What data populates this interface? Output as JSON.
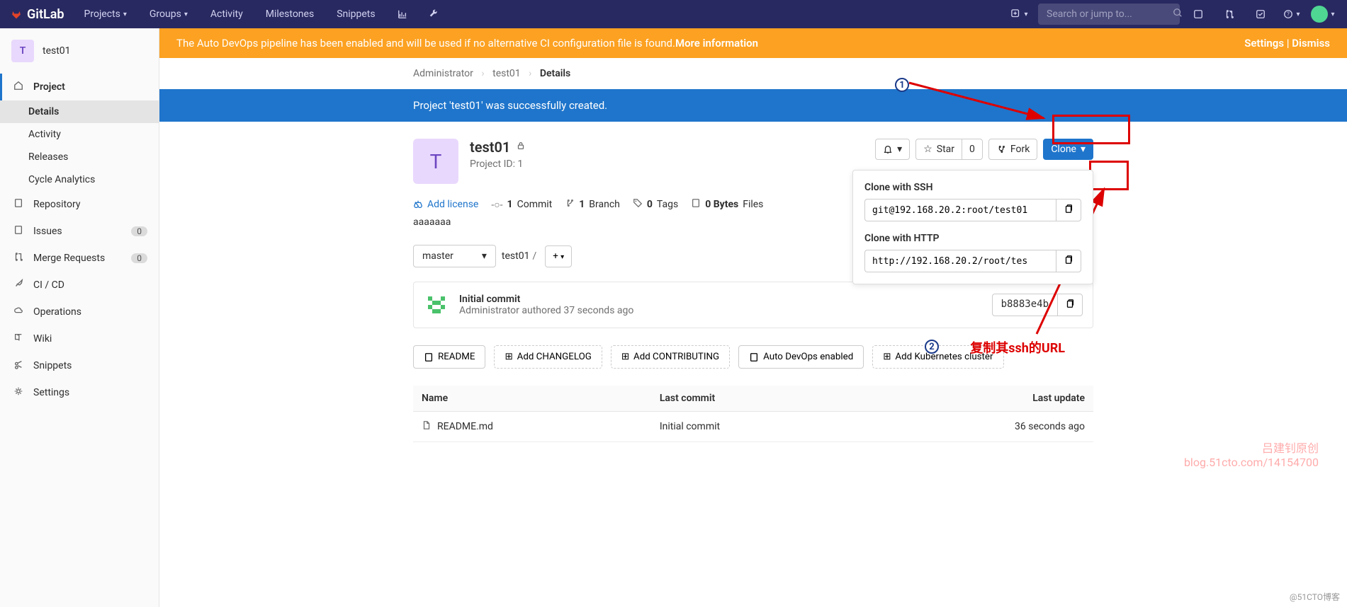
{
  "navbar": {
    "brand": "GitLab",
    "items": [
      "Projects",
      "Groups",
      "Activity",
      "Milestones",
      "Snippets"
    ],
    "search_placeholder": "Search or jump to..."
  },
  "sidebar": {
    "project_letter": "T",
    "project_name": "test01",
    "top_item": "Project",
    "sub_items": [
      "Details",
      "Activity",
      "Releases",
      "Cycle Analytics"
    ],
    "items": [
      {
        "label": "Repository"
      },
      {
        "label": "Issues",
        "badge": "0"
      },
      {
        "label": "Merge Requests",
        "badge": "0"
      },
      {
        "label": "CI / CD"
      },
      {
        "label": "Operations"
      },
      {
        "label": "Wiki"
      },
      {
        "label": "Snippets"
      },
      {
        "label": "Settings"
      }
    ]
  },
  "banner_warning": {
    "text": "The Auto DevOps pipeline has been enabled and will be used if no alternative CI configuration file is found. ",
    "link": "More information",
    "settings": "Settings",
    "dismiss": "Dismiss"
  },
  "breadcrumbs": [
    "Administrator",
    "test01",
    "Details"
  ],
  "banner_success": "Project 'test01' was successfully created.",
  "project": {
    "avatar_letter": "T",
    "name": "test01",
    "id_label": "Project ID: 1",
    "description": "aaaaaaa",
    "star_label": "Star",
    "star_count": "0",
    "fork_label": "Fork",
    "clone_label": "Clone"
  },
  "clone": {
    "ssh_title": "Clone with SSH",
    "ssh_url": "git@192.168.20.2:root/test01",
    "http_title": "Clone with HTTP",
    "http_url": "http://192.168.20.2/root/tes"
  },
  "stats": {
    "license": "Add license",
    "commits_n": "1",
    "commits": "Commit",
    "branches_n": "1",
    "branches": "Branch",
    "tags_n": "0",
    "tags": "Tags",
    "bytes_n": "0 Bytes",
    "bytes": "Files"
  },
  "branch": {
    "name": "master",
    "path": "test01"
  },
  "commit": {
    "title": "Initial commit",
    "meta": "Administrator authored 37 seconds ago",
    "sha": "b8883e4b"
  },
  "suggestions": [
    "README",
    "Add CHANGELOG",
    "Add CONTRIBUTING",
    "Auto DevOps enabled",
    "Add Kubernetes cluster"
  ],
  "files": {
    "headers": [
      "Name",
      "Last commit",
      "Last update"
    ],
    "rows": [
      {
        "name": "README.md",
        "commit": "Initial commit",
        "update": "36 seconds ago"
      }
    ]
  },
  "annotations": {
    "num1": "1",
    "num2": "2",
    "text2": "复制其ssh的URL"
  },
  "watermark1_line1": "吕建钊原创",
  "watermark1_line2": "blog.51cto.com/14154700",
  "watermark2": "@51CTO博客"
}
